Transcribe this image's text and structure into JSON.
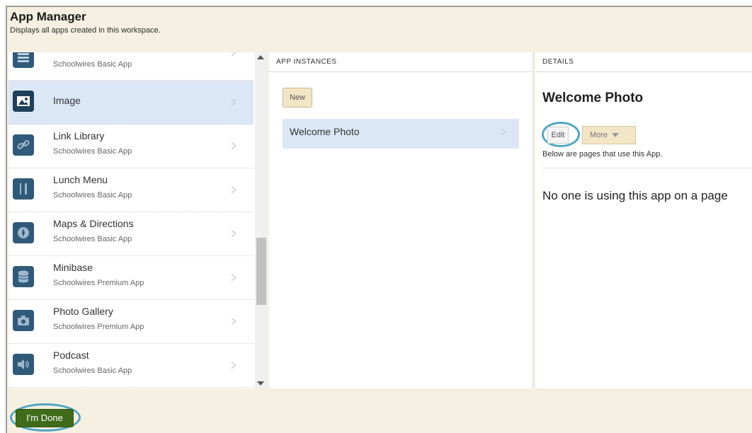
{
  "header": {
    "title": "App Manager",
    "subtitle": "Displays all apps created in this workspace."
  },
  "apps": [
    {
      "name": "",
      "type": "Schoolwires Basic App",
      "icon": "list-icon"
    },
    {
      "name": "Image",
      "type": "",
      "icon": "image-icon",
      "selected": true
    },
    {
      "name": "Link Library",
      "type": "Schoolwires Basic App",
      "icon": "link-icon"
    },
    {
      "name": "Lunch Menu",
      "type": "Schoolwires Basic App",
      "icon": "utensils-icon"
    },
    {
      "name": "Maps & Directions",
      "type": "Schoolwires Basic App",
      "icon": "compass-icon"
    },
    {
      "name": "Minibase",
      "type": "Schoolwires Premium App",
      "icon": "database-icon"
    },
    {
      "name": "Photo Gallery",
      "type": "Schoolwires Premium App",
      "icon": "camera-icon"
    },
    {
      "name": "Podcast",
      "type": "Schoolwires Basic App",
      "icon": "speaker-icon"
    }
  ],
  "instances": {
    "heading": "APP INSTANCES",
    "new_label": "New",
    "items": [
      {
        "name": "Welcome Photo",
        "selected": true
      }
    ]
  },
  "details": {
    "heading": "DETAILS",
    "title": "Welcome Photo",
    "edit_label": "Edit",
    "more_label": "More",
    "pages_note": "Below are pages that use this App.",
    "empty_message": "No one is using this app on a page"
  },
  "footer": {
    "done_label": "I'm Done"
  },
  "colors": {
    "frame_bg": "#f6f0e2",
    "selection": "#dce7f6",
    "icon_bg": "#2f5a7a",
    "done_button": "#3f6c1a",
    "highlight_ring": "#4fa7c4",
    "new_button": "#f3e6c6"
  }
}
